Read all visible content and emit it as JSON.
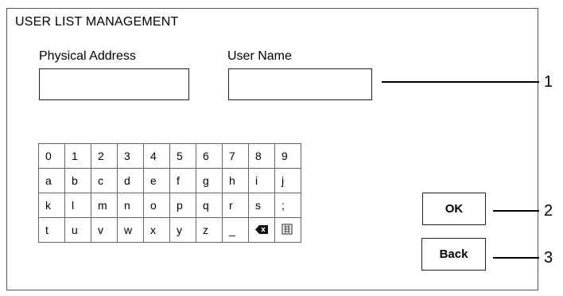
{
  "screen": {
    "title": "USER LIST MANAGEMENT"
  },
  "fields": {
    "physical_address": {
      "label": "Physical Address",
      "value": ""
    },
    "user_name": {
      "label": "User Name",
      "value": ""
    }
  },
  "keyboard": {
    "rows": [
      [
        "0",
        "1",
        "2",
        "3",
        "4",
        "5",
        "6",
        "7",
        "8",
        "9"
      ],
      [
        "a",
        "b",
        "c",
        "d",
        "e",
        "f",
        "g",
        "h",
        "i",
        "j"
      ],
      [
        "k",
        "l",
        "m",
        "n",
        "o",
        "p",
        "q",
        "r",
        "s",
        ";"
      ],
      [
        "t",
        "u",
        "v",
        "w",
        "x",
        "y",
        "z",
        "_",
        "backspace-icon",
        "symbol-switch-icon"
      ]
    ]
  },
  "buttons": {
    "ok": "OK",
    "back": "Back"
  },
  "callouts": [
    "1",
    "2",
    "3"
  ]
}
